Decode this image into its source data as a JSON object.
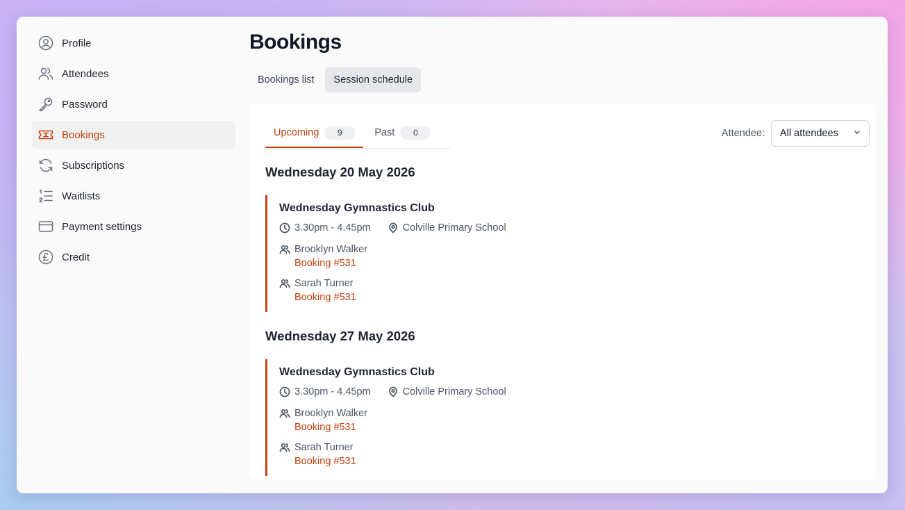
{
  "sidebar": {
    "items": [
      {
        "label": "Profile",
        "icon": "user-circle-icon"
      },
      {
        "label": "Attendees",
        "icon": "users-icon"
      },
      {
        "label": "Password",
        "icon": "key-icon"
      },
      {
        "label": "Bookings",
        "icon": "ticket-icon",
        "active": true
      },
      {
        "label": "Subscriptions",
        "icon": "refresh-icon"
      },
      {
        "label": "Waitlists",
        "icon": "numbered-list-icon"
      },
      {
        "label": "Payment settings",
        "icon": "credit-card-icon"
      },
      {
        "label": "Credit",
        "icon": "pound-circle-icon"
      }
    ]
  },
  "main": {
    "title": "Bookings",
    "tabs": [
      {
        "label": "Bookings list",
        "active": false
      },
      {
        "label": "Session schedule",
        "active": true
      }
    ],
    "sub_tabs": [
      {
        "label": "Upcoming",
        "count": "9",
        "active": true
      },
      {
        "label": "Past",
        "count": "0",
        "active": false
      }
    ],
    "filter": {
      "label": "Attendee:",
      "selected": "All attendees"
    },
    "days": [
      {
        "date": "Wednesday 20 May 2026",
        "session": {
          "title": "Wednesday Gymnastics Club",
          "time": "3.30pm - 4.45pm",
          "location": "Colville Primary School",
          "attendees": [
            {
              "name": "Brooklyn Walker",
              "booking": "Booking #531"
            },
            {
              "name": "Sarah Turner",
              "booking": "Booking #531"
            }
          ]
        }
      },
      {
        "date": "Wednesday 27 May 2026",
        "session": {
          "title": "Wednesday Gymnastics Club",
          "time": "3.30pm - 4.45pm",
          "location": "Colville Primary School",
          "attendees": [
            {
              "name": "Brooklyn Walker",
              "booking": "Booking #531"
            },
            {
              "name": "Sarah Turner",
              "booking": "Booking #531"
            }
          ]
        }
      }
    ]
  },
  "colors": {
    "accent": "#c2410c",
    "text": "#1f2430",
    "muted": "#4b5563"
  }
}
